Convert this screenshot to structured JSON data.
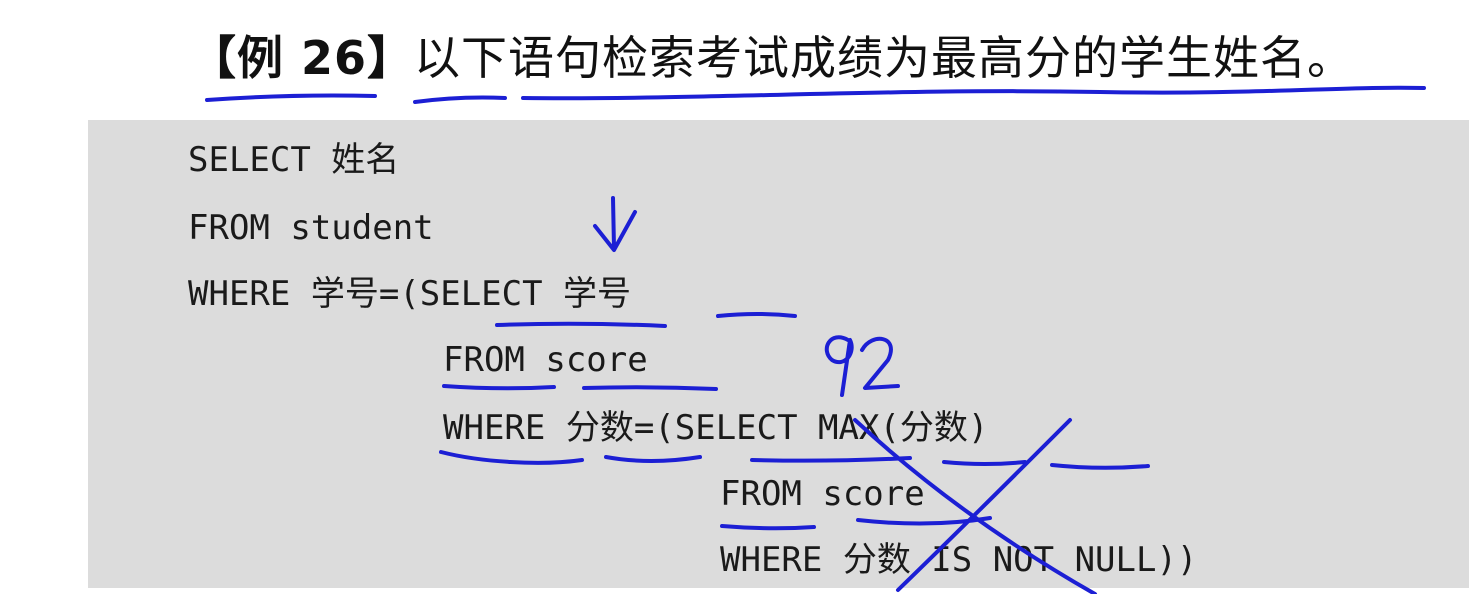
{
  "heading": {
    "label": "【例 26】",
    "text": "以下语句检索考试成绩为最高分的学生姓名。"
  },
  "code": {
    "line1": "SELECT 姓名",
    "line2": "FROM student",
    "line3": "WHERE 学号=(SELECT 学号",
    "line4": "FROM score",
    "line5": "WHERE 分数=(SELECT MAX(分数)",
    "line6": "FROM score",
    "line7": "WHERE 分数 IS NOT NULL))"
  },
  "annotations": {
    "handwritten_number": "92",
    "ink_color": "#1c1fd4",
    "code_background": "#dcdcdc"
  }
}
